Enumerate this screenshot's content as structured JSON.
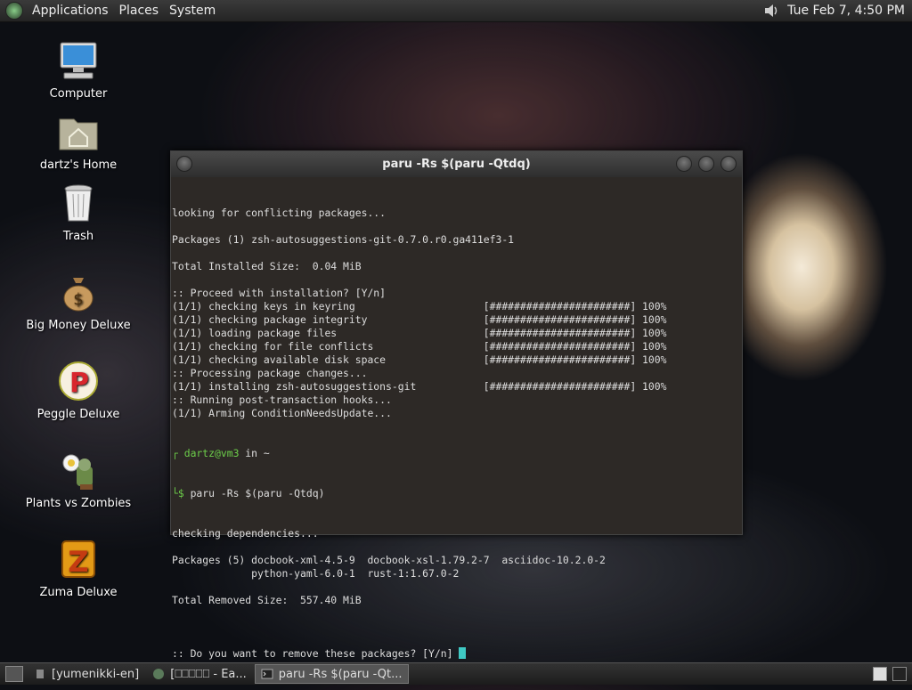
{
  "topbar": {
    "menus": [
      "Applications",
      "Places",
      "System"
    ],
    "clock": "Tue Feb  7,  4:50 PM"
  },
  "desktop_icons": [
    {
      "label": "Computer",
      "icon": "computer-icon"
    },
    {
      "label": "dartz's Home",
      "icon": "home-folder-icon"
    },
    {
      "label": "Trash",
      "icon": "trash-icon"
    },
    {
      "label": "Big Money Deluxe",
      "icon": "money-bag-icon"
    },
    {
      "label": "Peggle Deluxe",
      "icon": "peggle-icon"
    },
    {
      "label": "Plants vs Zombies",
      "icon": "plants-vs-zombies-icon"
    },
    {
      "label": "Zuma Deluxe",
      "icon": "zuma-icon"
    }
  ],
  "terminal": {
    "title": "paru -Rs $(paru -Qtdq)",
    "lines": [
      "looking for conflicting packages...",
      "",
      "Packages (1) zsh-autosuggestions-git-0.7.0.r0.ga411ef3-1",
      "",
      "Total Installed Size:  0.04 MiB",
      "",
      ":: Proceed with installation? [Y/n]",
      "(1/1) checking keys in keyring                     [#######################] 100%",
      "(1/1) checking package integrity                   [#######################] 100%",
      "(1/1) loading package files                        [#######################] 100%",
      "(1/1) checking for file conflicts                  [#######################] 100%",
      "(1/1) checking available disk space                [#######################] 100%",
      ":: Processing package changes...",
      "(1/1) installing zsh-autosuggestions-git           [#######################] 100%",
      ":: Running post-transaction hooks...",
      "(1/1) Arming ConditionNeedsUpdate..."
    ],
    "prompt_user": "dartz@vm3",
    "prompt_in": " in ~",
    "prompt_symbol": "$",
    "command": " paru -Rs $(paru -Qtdq)",
    "lines2": [
      "checking dependencies...",
      "",
      "Packages (5) docbook-xml-4.5-9  docbook-xsl-1.79.2-7  asciidoc-10.2.0-2",
      "             python-yaml-6.0-1  rust-1:1.67.0-2",
      "",
      "Total Removed Size:  557.40 MiB",
      ""
    ],
    "final_prompt": ":: Do you want to remove these packages? [Y/n] "
  },
  "taskbar": {
    "tasks": [
      {
        "label": "[yumenikki-en]",
        "active": false
      },
      {
        "label": "[⎕⎕⎕⎕⎕ - Ea...",
        "active": false
      },
      {
        "label": "paru -Rs $(paru -Qt...",
        "active": true
      }
    ]
  }
}
